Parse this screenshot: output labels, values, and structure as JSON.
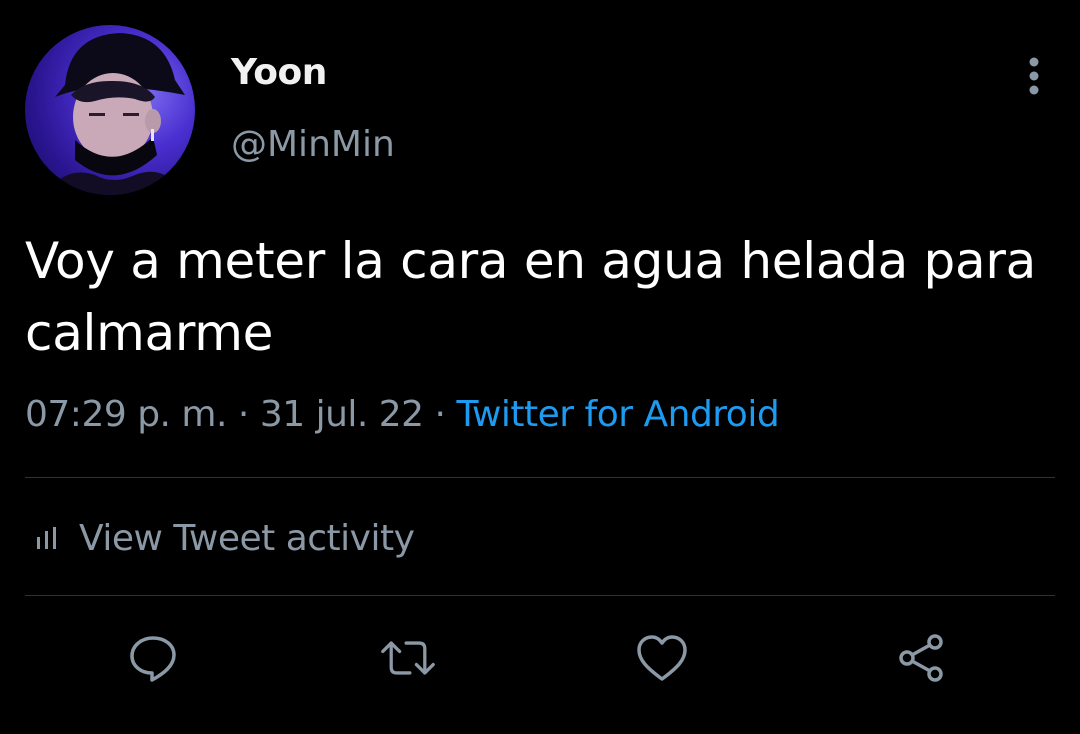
{
  "tweet": {
    "author": {
      "display_name": "Yoon",
      "handle": "@MinMin",
      "avatar_icon": "avatar-photo"
    },
    "more_icon": "more-vertical-icon",
    "text_line1": "Voy a meter la cara en agua helada para",
    "text_line2": "calmarme",
    "meta": {
      "time": "07:29 p. m.",
      "separator": "·",
      "date": "31 jul. 22",
      "source": "Twitter for Android"
    },
    "activity": {
      "icon": "analytics-bars-icon",
      "label": "View Tweet activity"
    },
    "actions": [
      {
        "icon": "reply-icon"
      },
      {
        "icon": "retweet-icon"
      },
      {
        "icon": "like-icon"
      },
      {
        "icon": "share-icon"
      }
    ]
  },
  "colors": {
    "background": "#000000",
    "primary_text": "#ffffff",
    "secondary_text": "#8b98a5",
    "link": "#1d9bf0",
    "divider": "#2f3336"
  }
}
